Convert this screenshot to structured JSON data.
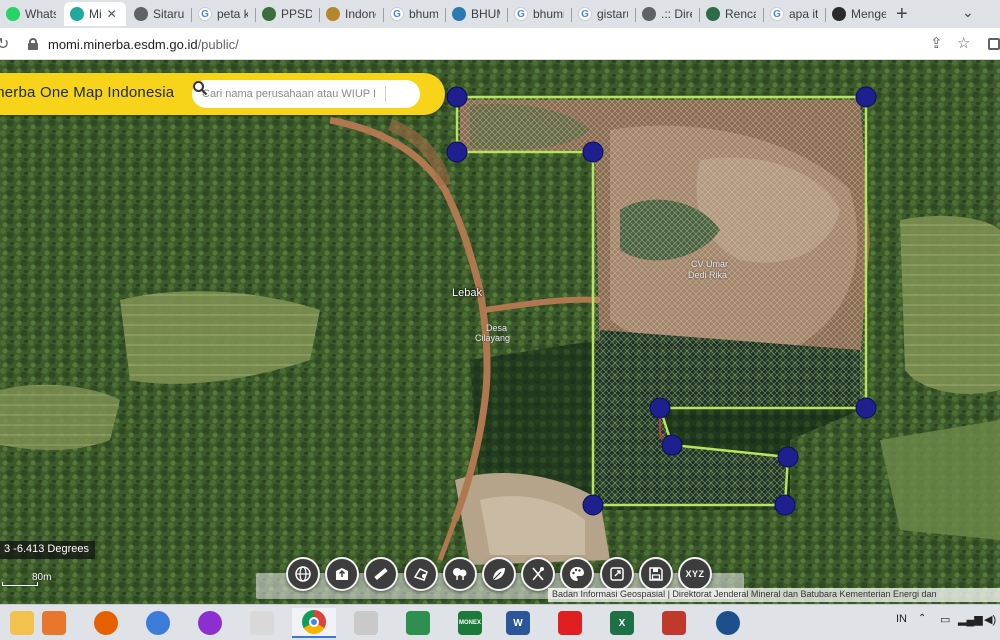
{
  "browser": {
    "tabs": [
      {
        "label": "Whats",
        "icon": "whatsapp-icon",
        "color": "#25d366"
      },
      {
        "label": "Mi",
        "icon": "minerba-icon",
        "color": "#20a9a0",
        "active": true
      },
      {
        "label": "Sitarun",
        "icon": "globe-icon",
        "color": "#5f6368"
      },
      {
        "label": "peta kr",
        "icon": "google-icon",
        "color": "#4285f4"
      },
      {
        "label": "PPSDM",
        "icon": "ppsdm-icon",
        "color": "#3b6e3b"
      },
      {
        "label": "Indone",
        "icon": "garuda-icon",
        "color": "#b5862d"
      },
      {
        "label": "bhumi",
        "icon": "google-icon",
        "color": "#4285f4"
      },
      {
        "label": "BHUM",
        "icon": "bhumi-icon",
        "color": "#2a7aaf"
      },
      {
        "label": "bhumi",
        "icon": "google-icon",
        "color": "#4285f4"
      },
      {
        "label": "gistaru",
        "icon": "google-icon",
        "color": "#4285f4"
      },
      {
        "label": ".:: Direl",
        "icon": "globe-icon",
        "color": "#5f6368"
      },
      {
        "label": "Rencan",
        "icon": "rencana-icon",
        "color": "#2f6b45"
      },
      {
        "label": "apa itu",
        "icon": "google-icon",
        "color": "#4285f4"
      },
      {
        "label": "Menge",
        "icon": "menge-icon",
        "color": "#2a2a2a"
      }
    ],
    "close_glyph": "✕",
    "new_tab_glyph": "+",
    "menu_glyph": "⌄",
    "url_host": "momi.minerba.esdm.go.id",
    "url_path": "/public/",
    "toolbar_icons": [
      "reload-icon",
      "share-icon",
      "bookmark-star-icon",
      "profile-icon"
    ]
  },
  "app": {
    "title": "Minerba One Map Indonesia",
    "search_placeholder": "Cari nama perusahaan atau WIUP I"
  },
  "map": {
    "labels": {
      "kabupaten": "Lebak",
      "desa_line1": "Desa",
      "desa_line2": "Cilayang",
      "concession_line1": "CV Umar",
      "concession_line2": "Dedi Rika"
    },
    "coordinate_readout": "3 -6.413 Degrees",
    "scale_label": "80m",
    "attribution": "Badan Informasi Geospasial | Direktorat Jenderal Mineral dan Batubara Kementerian Energi dan",
    "colors": {
      "boundary": "#b8e35a",
      "vertex": "#1f1f8f",
      "hatch": "#d8d0e0",
      "header": "#f7d31a"
    }
  },
  "tools": [
    {
      "name": "basemap-globe-tool",
      "icon": "globe-icon"
    },
    {
      "name": "upload-layer-tool",
      "icon": "map-upload-icon"
    },
    {
      "name": "measure-tool",
      "icon": "ruler-icon"
    },
    {
      "name": "draw-area-tool",
      "icon": "polygon-pen-icon"
    },
    {
      "name": "layer-tree-tool",
      "icon": "tree-icon"
    },
    {
      "name": "vegetation-tool",
      "icon": "leaf-icon"
    },
    {
      "name": "cut-fill-tool",
      "icon": "scissors-map-icon"
    },
    {
      "name": "palette-tool",
      "icon": "palette-icon"
    },
    {
      "name": "export-tool",
      "icon": "export-icon"
    },
    {
      "name": "save-tool",
      "icon": "floppy-icon"
    },
    {
      "name": "coordinate-tool",
      "icon": "xyz-icon",
      "text": "XYZ"
    }
  ],
  "taskbar": {
    "apps": [
      {
        "name": "file-explorer",
        "color": "#f2c14e"
      },
      {
        "name": "media-player",
        "color": "#e8762c"
      },
      {
        "name": "firefox",
        "color": "#e66000"
      },
      {
        "name": "google-earth",
        "color": "#3d7bd8"
      },
      {
        "name": "mascot-app",
        "color": "#8b2fd1"
      },
      {
        "name": "paint-app",
        "color": "#d9d9d9"
      },
      {
        "name": "chrome",
        "color": "#db4437",
        "running": true
      },
      {
        "name": "calculator",
        "color": "#c9c9c9"
      },
      {
        "name": "metatrader",
        "color": "#2f8f4e"
      },
      {
        "name": "monex",
        "color": "#1b7a3a",
        "text": "MONEX"
      },
      {
        "name": "word",
        "color": "#2b579a",
        "text": "W"
      },
      {
        "name": "pdf-reader",
        "color": "#e02020"
      },
      {
        "name": "excel",
        "color": "#1e7145",
        "text": "X"
      },
      {
        "name": "app-suite",
        "color": "#c0392b"
      },
      {
        "name": "earth-viewer",
        "color": "#1c4f8c"
      }
    ],
    "language": "IN"
  }
}
